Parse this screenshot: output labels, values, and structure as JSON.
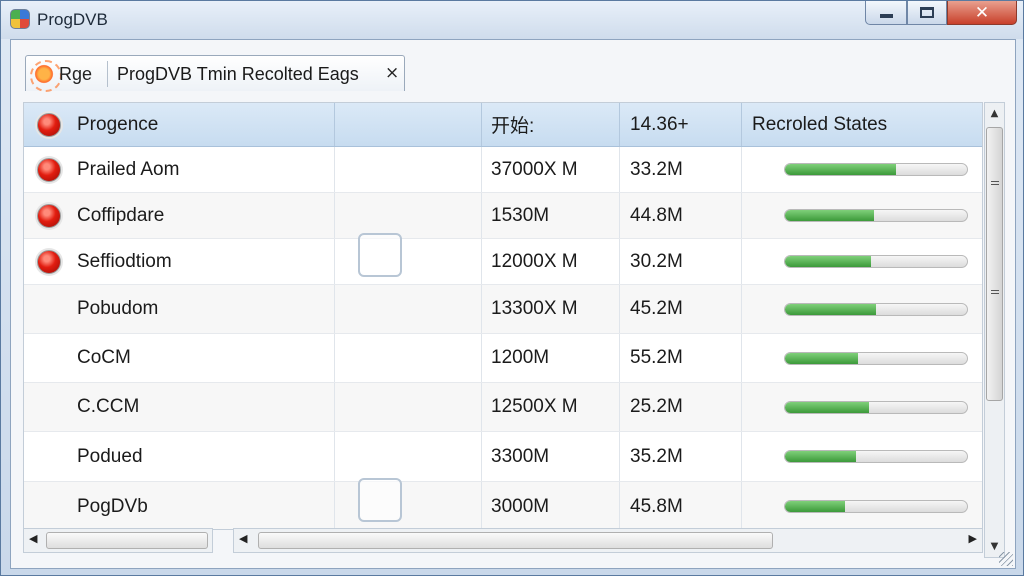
{
  "window": {
    "title": "ProgDVB",
    "icon": "progdvb-app-icon",
    "controls": {
      "minimize": "minimize-icon",
      "maximize": "maximize-icon",
      "close": "close-icon"
    }
  },
  "tab": {
    "icon": "sun-icon",
    "short_label": "Rge",
    "label": "ProgDVB Tmin Recolted Eags",
    "close": "×"
  },
  "table": {
    "columns": [
      "Progence",
      "",
      "开始:",
      "14.36+",
      "Recroled States"
    ],
    "rows": [
      {
        "name": "Prailed Aom",
        "status": "red-dot",
        "size": "37000X M",
        "rate": "33.2M",
        "progress": 0.61
      },
      {
        "name": "Coffipdare",
        "status": "red-dot",
        "size": "1530M",
        "rate": "44.8M",
        "progress": 0.49
      },
      {
        "name": "Seffiodtiom",
        "status": "red-dot",
        "size": "12000X M",
        "rate": "30.2M",
        "progress": 0.47
      },
      {
        "name": "Pobudom",
        "status": "",
        "size": "13300X M",
        "rate": "45.2M",
        "progress": 0.5
      },
      {
        "name": "CoCM",
        "status": "",
        "size": "1200M",
        "rate": "55.2M",
        "progress": 0.4
      },
      {
        "name": "C.CCM",
        "status": "",
        "size": "12500X M",
        "rate": "25.2M",
        "progress": 0.46
      },
      {
        "name": "Podued",
        "status": "",
        "size": "3300M",
        "rate": "35.2M",
        "progress": 0.39
      },
      {
        "name": "PogDVb",
        "status": "",
        "size": "3000M",
        "rate": "45.8M",
        "progress": 0.33
      }
    ]
  },
  "colors": {
    "header_bg": "#c7dcf0",
    "progress_fill": "#4caf50",
    "status_dot": "#e21d10"
  }
}
